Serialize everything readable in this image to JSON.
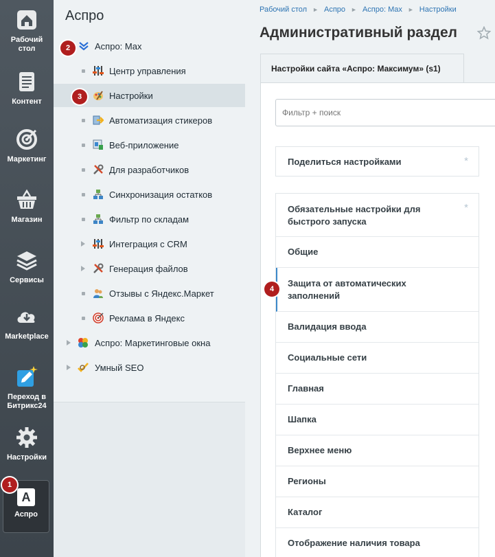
{
  "rail": {
    "items": [
      {
        "label_1": "Рабочий",
        "label_2": "стол",
        "icon": "home-icon"
      },
      {
        "label_1": "Контент",
        "icon": "document-icon"
      },
      {
        "label_1": "Маркетинг",
        "icon": "target-icon"
      },
      {
        "label_1": "Магазин",
        "icon": "basket-icon"
      },
      {
        "label_1": "Сервисы",
        "icon": "layers-icon"
      },
      {
        "label_1": "Marketplace",
        "icon": "cloud-download-icon"
      },
      {
        "label_1": "Переход в",
        "label_2": "Битрикс24",
        "icon": "edit-sparkle-icon"
      },
      {
        "label_1": "Настройки",
        "icon": "gear-icon"
      },
      {
        "label_1": "Аспро",
        "letter": "A",
        "icon": "aspro-letter-icon"
      }
    ]
  },
  "menu": {
    "title": "Аспро",
    "items": [
      {
        "label": "Аспро: Max",
        "icon": "aspro-max-logo-icon"
      },
      {
        "label": "Центр управления",
        "icon": "control-panel-icon"
      },
      {
        "label": "Настройки",
        "icon": "palette-icon"
      },
      {
        "label": "Автоматизация стикеров",
        "icon": "sticker-arrow-icon"
      },
      {
        "label": "Веб-приложение",
        "icon": "web-app-icon"
      },
      {
        "label": "Для разработчиков",
        "icon": "tools-icon"
      },
      {
        "label": "Синхронизация остатков",
        "icon": "hierarchy-icon"
      },
      {
        "label": "Фильтр по складам",
        "icon": "hierarchy-icon"
      },
      {
        "label": "Интеграция с CRM",
        "icon": "crm-bars-icon"
      },
      {
        "label": "Генерация файлов",
        "icon": "tools-icon"
      },
      {
        "label": "Отзывы с Яндекс.Маркет",
        "icon": "users-icon"
      },
      {
        "label": "Реклама в Яндекс",
        "icon": "target-small-icon"
      },
      {
        "label": "Аспро: Маркетинговые окна",
        "icon": "windows-color-icon"
      },
      {
        "label": "Умный SEO",
        "icon": "seo-check-icon"
      }
    ]
  },
  "badges": [
    "1",
    "2",
    "3",
    "4"
  ],
  "breadcrumb": [
    "Рабочий стол",
    "Аспро",
    "Аспро: Max",
    "Настройки"
  ],
  "page_title": "Административный раздел",
  "tab_label": "Настройки сайта «Аспро: Максимум» (s1)",
  "filter_placeholder": "Фильтр + поиск",
  "share_settings": "Поделиться настройками",
  "settings_list": [
    {
      "line1": "Обязательные настройки для",
      "line2": "быстрого запуска",
      "pin": "*"
    },
    {
      "line1": "Общие"
    },
    {
      "line1": "Защита от автоматических",
      "line2": "заполнений"
    },
    {
      "line1": "Валидация ввода"
    },
    {
      "line1": "Социальные сети"
    },
    {
      "line1": "Главная"
    },
    {
      "line1": "Шапка"
    },
    {
      "line1": "Верхнее меню"
    },
    {
      "line1": "Регионы"
    },
    {
      "line1": "Каталог"
    },
    {
      "line1": "Отображение наличия товара"
    }
  ],
  "pin_symbol": "*",
  "colors": {
    "accent": "#3b88c9",
    "badge": "#b01e1e",
    "rail": "#454d54"
  }
}
